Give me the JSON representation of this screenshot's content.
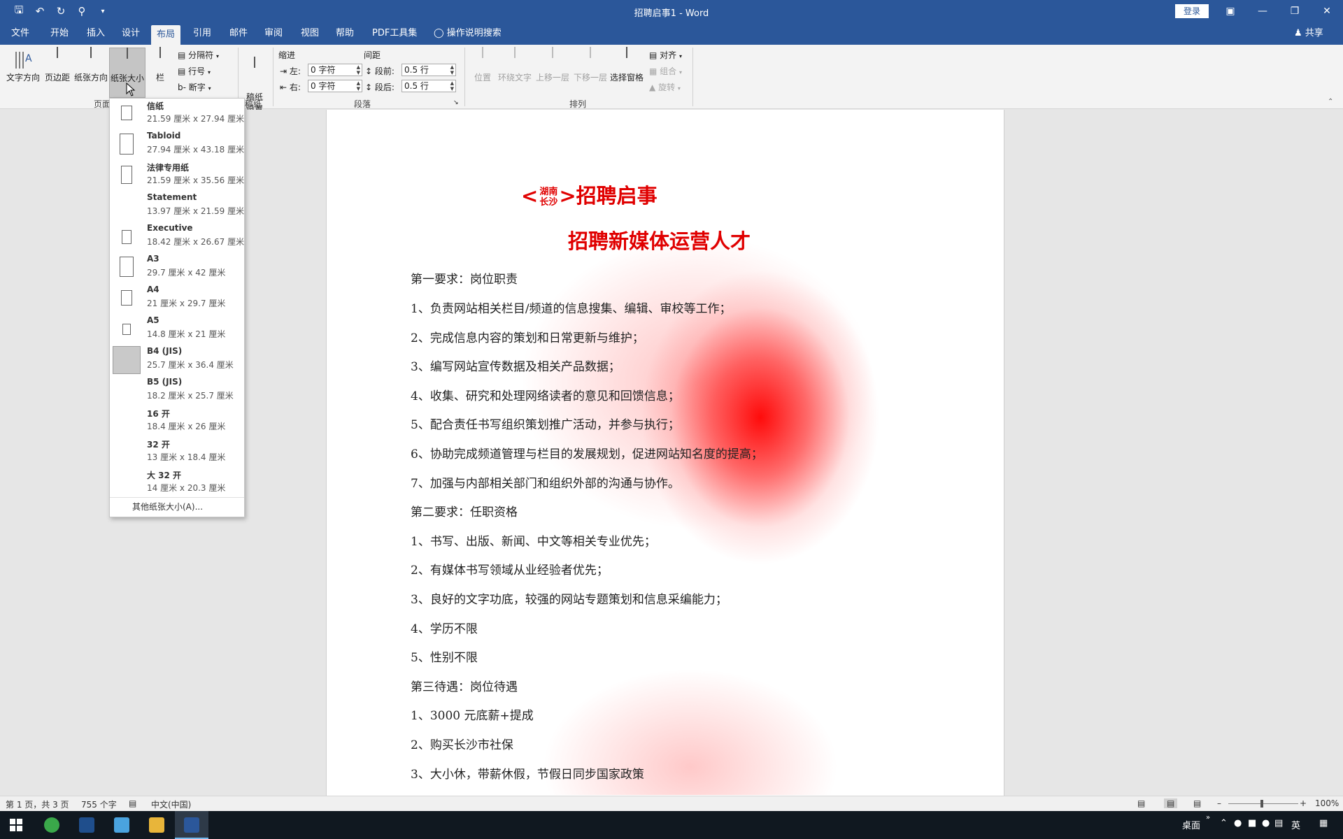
{
  "titlebar": {
    "doc_title": "招聘启事1  -  Word",
    "login_label": "登录",
    "quick_access": [
      "save-icon",
      "undo-icon",
      "redo-icon",
      "find-icon",
      "customize-icon"
    ]
  },
  "tabs": {
    "items": [
      "文件",
      "开始",
      "插入",
      "设计",
      "布局",
      "引用",
      "邮件",
      "审阅",
      "视图",
      "帮助",
      "PDF工具集"
    ],
    "active": "布局",
    "tell_me": "操作说明搜索",
    "share": "共享"
  },
  "ribbon": {
    "page_setup": {
      "text_direction": "文字方向",
      "margins": "页边距",
      "orientation": "纸张方向",
      "size": "纸张大小",
      "columns": "栏",
      "breaks": "分隔符",
      "line_numbers": "行号",
      "hyphenation": "断字",
      "group_label": "页面"
    },
    "manuscript": {
      "settings": "稿纸\n设置",
      "group_label": "稿纸"
    },
    "paragraph": {
      "indent_label": "缩进",
      "spacing_label": "间距",
      "left_label": "左:",
      "right_label": "右:",
      "before_label": "段前:",
      "after_label": "段后:",
      "indent_left": "0 字符",
      "indent_right": "0 字符",
      "spacing_before": "0.5 行",
      "spacing_after": "0.5 行",
      "group_label": "段落"
    },
    "arrange": {
      "position": "位置",
      "wrap_text": "环绕文字",
      "bring_forward": "上移一层",
      "send_backward": "下移一层",
      "selection_pane": "选择窗格",
      "align": "对齐",
      "group": "组合",
      "rotate": "旋转",
      "group_label": "排列"
    }
  },
  "paper_size_menu": {
    "items": [
      {
        "name": "信纸",
        "size": "21.59 厘米 x 27.94 厘米"
      },
      {
        "name": "Tabloid",
        "size": "27.94 厘米 x 43.18 厘米"
      },
      {
        "name": "法律专用纸",
        "size": "21.59 厘米 x 35.56 厘米"
      },
      {
        "name": "Statement",
        "size": "13.97 厘米 x 21.59 厘米"
      },
      {
        "name": "Executive",
        "size": "18.42 厘米 x 26.67 厘米"
      },
      {
        "name": "A3",
        "size": "29.7 厘米 x 42 厘米"
      },
      {
        "name": "A4",
        "size": "21 厘米 x 29.7 厘米"
      },
      {
        "name": "A5",
        "size": "14.8 厘米 x 21 厘米"
      },
      {
        "name": "B4 (JIS)",
        "size": "25.7 厘米 x 36.4 厘米"
      },
      {
        "name": "B5 (JIS)",
        "size": "18.2 厘米 x 25.7 厘米"
      },
      {
        "name": "16 开",
        "size": "18.4 厘米 x 26 厘米"
      },
      {
        "name": "32 开",
        "size": "13 厘米 x 18.4 厘米"
      },
      {
        "name": "大 32 开",
        "size": "14 厘米 x 20.3 厘米"
      }
    ],
    "selected": "B4 (JIS)",
    "more": "其他纸张大小(A)..."
  },
  "document": {
    "heading1_prefix": "<",
    "heading1_ruby_top": "湖南",
    "heading1_ruby_bottom": "长沙",
    "heading1_suffix": ">招聘启事",
    "heading2": "招聘新媒体运营人才",
    "lines": [
      "第一要求：岗位职责",
      "1、负责网站相关栏目/频道的信息搜集、编辑、审校等工作；",
      "2、完成信息内容的策划和日常更新与维护；",
      "3、编写网站宣传数据及相关产品数据；",
      "4、收集、研究和处理网络读者的意见和回馈信息；",
      "5、配合责任书写组织策划推广活动，并参与执行；",
      "6、协助完成频道管理与栏目的发展规划，促进网站知名度的提高；",
      "7、加强与内部相关部门和组织外部的沟通与协作。",
      "第二要求：任职资格",
      "1、书写、出版、新闻、中文等相关专业优先；",
      "2、有媒体书写领域从业经验者优先；",
      "3、良好的文字功底，较强的网站专题策划和信息采编能力；",
      "4、学历不限",
      "5、性别不限",
      "第三待遇：岗位待遇",
      "1、3000 元底薪+提成",
      "2、购买长沙市社保",
      "3、大小休，带薪休假，节假日同步国家政策"
    ]
  },
  "statusbar": {
    "page": "第 1 页，共 3 页",
    "words": "755 个字",
    "language": "中文(中国)",
    "zoom": "100%"
  },
  "taskbar": {
    "desktop_label": "桌面",
    "ime": "英"
  },
  "colors": {
    "word_blue": "#2b579a",
    "heading_red": "#e00000"
  }
}
